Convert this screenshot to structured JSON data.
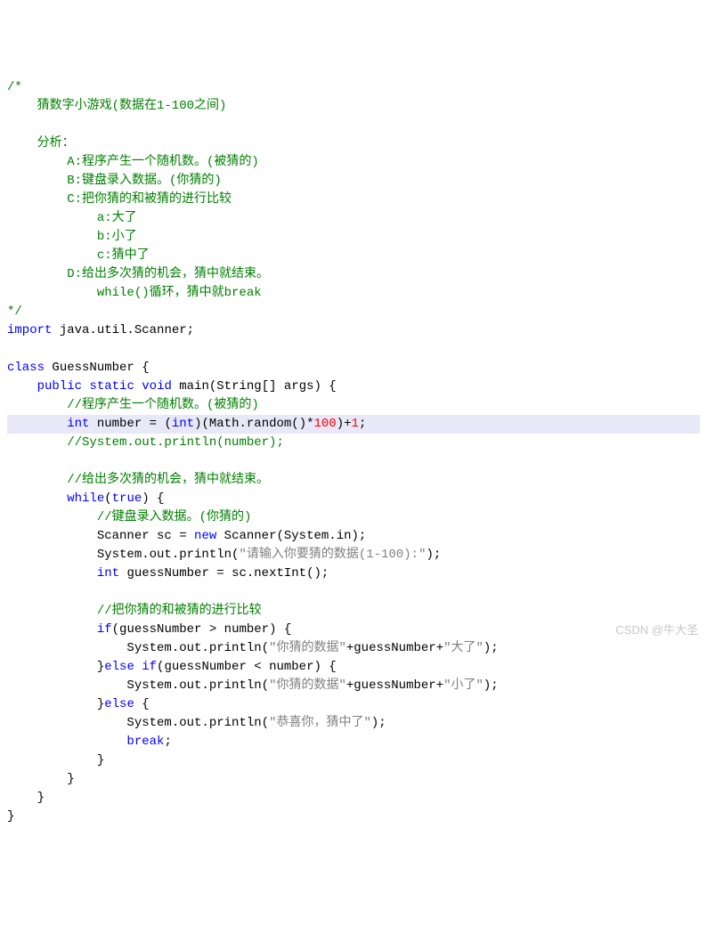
{
  "comments": {
    "header_open": "/*",
    "h1": "    猜数字小游戏(数据在1-100之间)",
    "h2": "    分析：",
    "h3": "        A:程序产生一个随机数。(被猜的)",
    "h4": "        B:键盘录入数据。(你猜的)",
    "h5": "        C:把你猜的和被猜的进行比较",
    "h6": "            a:大了",
    "h7": "            b:小了",
    "h8": "            c:猜中了",
    "h9": "        D:给出多次猜的机会，猜中就结束。",
    "h10": "            while()循环，猜中就break",
    "header_close": "*/",
    "c1": "//程序产生一个随机数。(被猜的)",
    "c2": "//System.out.println(number);",
    "c3": "//给出多次猜的机会，猜中就结束。",
    "c4": "//键盘录入数据。(你猜的)",
    "c5": "//把你猜的和被猜的进行比较"
  },
  "kw": {
    "import": "import",
    "class": "class",
    "public": "public",
    "static": "static",
    "void": "void",
    "int": "int",
    "int2": "int",
    "int_cast": "int",
    "new": "new",
    "while": "while",
    "true": "true",
    "if": "if",
    "else_if": "else if",
    "else": "else",
    "break": "break"
  },
  "code": {
    "import_rest": " java.util.Scanner;",
    "class_name": " GuessNumber {",
    "main_sig": " main(String[] args) {",
    "number_assign_pre": " number = (",
    "number_assign_mid": ")(Math.random()*",
    "number_assign_post": ")+",
    "semi": ";",
    "while_open": "(",
    "while_close": ") {",
    "sc_decl": "            Scanner sc = ",
    "sc_new": " Scanner(System.in);",
    "println1_a": "            System.out.println(",
    "println1_b": ");",
    "guess_decl": " guessNumber = sc.nextInt();",
    "if_cond": "(guessNumber > number) {",
    "println2_a": "                System.out.println(",
    "println2_b": "+guessNumber+",
    "println2_c": ");",
    "elseif_cond": "(guessNumber < number) {",
    "println3_a": "                System.out.println(",
    "println3_b": "+guessNumber+",
    "println3_c": ");",
    "else_open": " {",
    "println4_a": "                System.out.println(",
    "println4_b": ");",
    "break_line": ";",
    "brace_close1": "            }",
    "brace_close2": "        }",
    "brace_close3": "    }",
    "brace_close4": "}",
    "elseif_close": "}",
    "space12": "            ",
    "space8": "        ",
    "space16": "                "
  },
  "nums": {
    "hundred": "100",
    "one": "1"
  },
  "strs": {
    "s1": "\"请输入你要猜的数据(1-100):\"",
    "s2": "\"你猜的数据\"",
    "s3": "\"大了\"",
    "s4": "\"你猜的数据\"",
    "s5": "\"小了\"",
    "s6": "\"恭喜你，猜中了\""
  },
  "watermark": "CSDN @牛大圣"
}
